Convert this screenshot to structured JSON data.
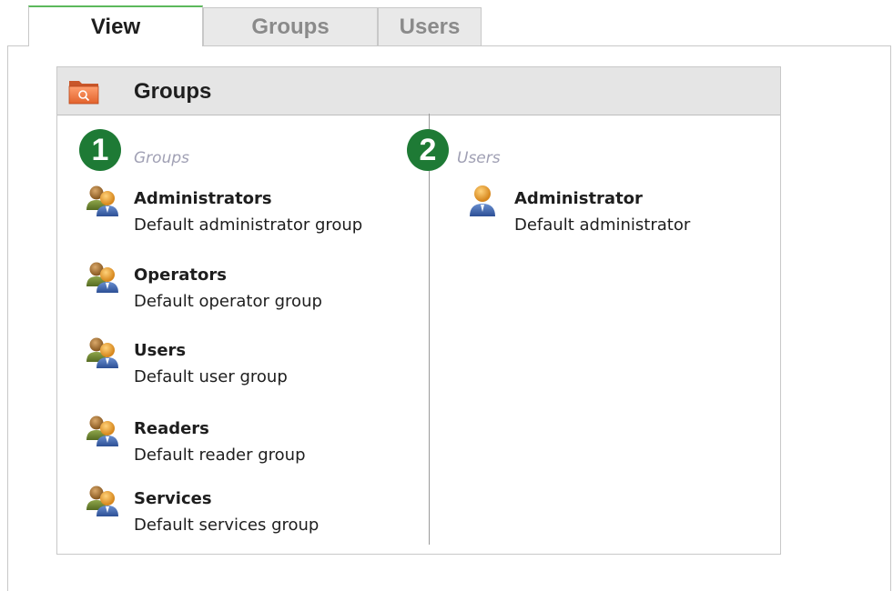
{
  "tabs": [
    {
      "label": "View",
      "active": true
    },
    {
      "label": "Groups",
      "active": false
    },
    {
      "label": "Users",
      "active": false
    }
  ],
  "panel": {
    "title": "Groups",
    "icon": "folder-search-icon"
  },
  "groups_section": {
    "badge": "1",
    "label": "Groups",
    "items": [
      {
        "name": "Administrators",
        "description": "Default administrator group",
        "icon": "user-group-icon"
      },
      {
        "name": "Operators",
        "description": "Default operator group",
        "icon": "user-group-icon"
      },
      {
        "name": "Users",
        "description": "Default user group",
        "icon": "user-group-icon"
      },
      {
        "name": "Readers",
        "description": "Default reader group",
        "icon": "user-group-icon"
      },
      {
        "name": "Services",
        "description": "Default services group",
        "icon": "user-group-icon"
      }
    ]
  },
  "users_section": {
    "badge": "2",
    "label": "Users",
    "items": [
      {
        "name": "Administrator",
        "description": "Default administrator",
        "icon": "user-icon"
      }
    ]
  },
  "colors": {
    "badge": "#1e7a35",
    "active_tab_accent": "#5cb85c",
    "header_bg": "#e5e5e5",
    "section_label": "#a0a0b4"
  }
}
